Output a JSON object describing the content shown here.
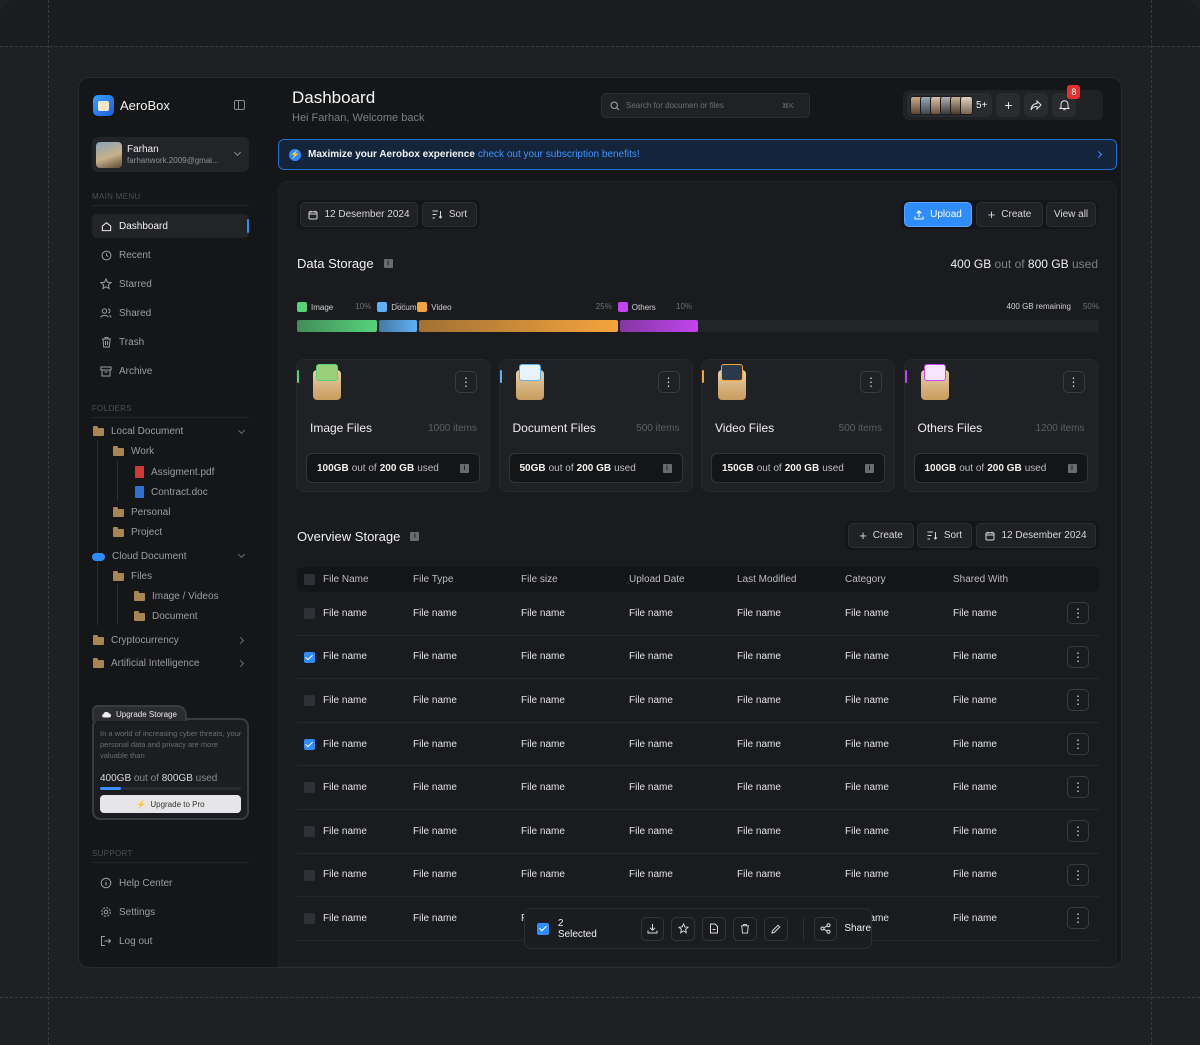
{
  "app": {
    "name": "AeroBox",
    "user": {
      "name": "Farhan",
      "email": "farhanwork.2009@gmai..."
    }
  },
  "sidebar": {
    "main_menu_label": "MAIN MENU",
    "menu": [
      {
        "label": "Dashboard",
        "icon": "home-icon",
        "active": true
      },
      {
        "label": "Recent",
        "icon": "clock-icon"
      },
      {
        "label": "Starred",
        "icon": "star-icon"
      },
      {
        "label": "Shared",
        "icon": "users-icon"
      },
      {
        "label": "Trash",
        "icon": "trash-icon"
      },
      {
        "label": "Archive",
        "icon": "archive-icon"
      }
    ],
    "folders_label": "FOLDERS",
    "folders": {
      "local": "Local Document",
      "work": "Work",
      "assignment": "Assigment.pdf",
      "contract": "Contract.doc",
      "personal": "Personal",
      "project": "Project",
      "cloud": "Cloud Document",
      "files": "Files",
      "image_videos": "Image / Videos",
      "document": "Document",
      "crypto": "Cryptocurrency",
      "ai": "Artificial Intelligence"
    },
    "upgrade": {
      "title": "Upgrade Storage",
      "description": "In a world of increasing cyber threats, your personal data and privacy are more valuable than",
      "used": "400GB",
      "out_of_text": "out of",
      "total": "800GB",
      "used_text": "used",
      "fill": 0.5,
      "button": "Upgrade to Pro"
    },
    "support_label": "SUPPORT",
    "support": [
      {
        "label": "Help Center",
        "icon": "help-icon"
      },
      {
        "label": "Settings",
        "icon": "gear-icon"
      },
      {
        "label": "Log out",
        "icon": "logout-icon"
      }
    ]
  },
  "header": {
    "title": "Dashboard",
    "subtitle": "Hei Farhan, Welcome back",
    "search_placeholder": "Search for documen or files",
    "search_shortcut": "⌘K",
    "more_members": "5+",
    "notification_count": "8"
  },
  "banner": {
    "strong": "Maximize your Aerobox experience",
    "link": "check out your subscription benefits!"
  },
  "toolbar": {
    "date": "12 Desember 2024",
    "sort": "Sort",
    "upload": "Upload",
    "create": "Create",
    "view_all": "View all"
  },
  "storage": {
    "title": "Data Storage",
    "used": "400 GB",
    "out_of": "out of",
    "total": "800 GB",
    "used_suffix": "used",
    "remaining": "400 GB remaining",
    "remaining_pct": "50%",
    "segments": [
      {
        "label": "Image",
        "pct": "10%",
        "value": 10,
        "color": "#57d27a"
      },
      {
        "label": "Document",
        "pct": "5%",
        "value": 5,
        "color": "#5fb0f5"
      },
      {
        "label": "Video",
        "pct": "25%",
        "value": 25,
        "color": "#f5a43c"
      },
      {
        "label": "Others",
        "pct": "10%",
        "value": 10,
        "color": "#c244f0"
      }
    ]
  },
  "cards": [
    {
      "title": "Image Files",
      "count": "1000 items",
      "used": "100GB",
      "mid": "out of",
      "total": "200 GB",
      "suffix": "used",
      "accent": "#57d27a"
    },
    {
      "title": "Document Files",
      "count": "500 items",
      "used": "50GB",
      "mid": "out of",
      "total": "200 GB",
      "suffix": "used",
      "accent": "#5fb0f5"
    },
    {
      "title": "Video Files",
      "count": "500 items",
      "used": "150GB",
      "mid": "out of",
      "total": "200 GB",
      "suffix": "used",
      "accent": "#f5a43c"
    },
    {
      "title": "Others Files",
      "count": "1200 items",
      "used": "100GB",
      "mid": "out of",
      "total": "200 GB",
      "suffix": "used",
      "accent": "#c244f0"
    }
  ],
  "overview": {
    "title": "Overview Storage",
    "create": "Create",
    "sort": "Sort",
    "date": "12 Desember 2024",
    "columns": [
      "File Name",
      "File Type",
      "File size",
      "Upload Date",
      "Last Modified",
      "Category",
      "Shared With"
    ],
    "rows": [
      {
        "checked": false,
        "cells": [
          "File name",
          "File name",
          "File name",
          "File name",
          "File name",
          "File name",
          "File name"
        ]
      },
      {
        "checked": true,
        "cells": [
          "File name",
          "File name",
          "File name",
          "File name",
          "File name",
          "File name",
          "File name"
        ]
      },
      {
        "checked": false,
        "cells": [
          "File name",
          "File name",
          "File name",
          "File name",
          "File name",
          "File name",
          "File name"
        ]
      },
      {
        "checked": true,
        "cells": [
          "File name",
          "File name",
          "File name",
          "File name",
          "File name",
          "File name",
          "File name"
        ]
      },
      {
        "checked": false,
        "cells": [
          "File name",
          "File name",
          "File name",
          "File name",
          "File name",
          "File name",
          "File name"
        ]
      },
      {
        "checked": false,
        "cells": [
          "File name",
          "File name",
          "File name",
          "File name",
          "File name",
          "File name",
          "File name"
        ]
      },
      {
        "checked": false,
        "cells": [
          "File name",
          "File name",
          "File name",
          "File name",
          "File name",
          "File name",
          "File name"
        ]
      },
      {
        "checked": false,
        "cells": [
          "File name",
          "File name",
          "File name",
          "File name",
          "File name",
          "File name",
          "File name"
        ]
      }
    ]
  },
  "selection": {
    "label": "2 Selected",
    "share": "Share"
  }
}
